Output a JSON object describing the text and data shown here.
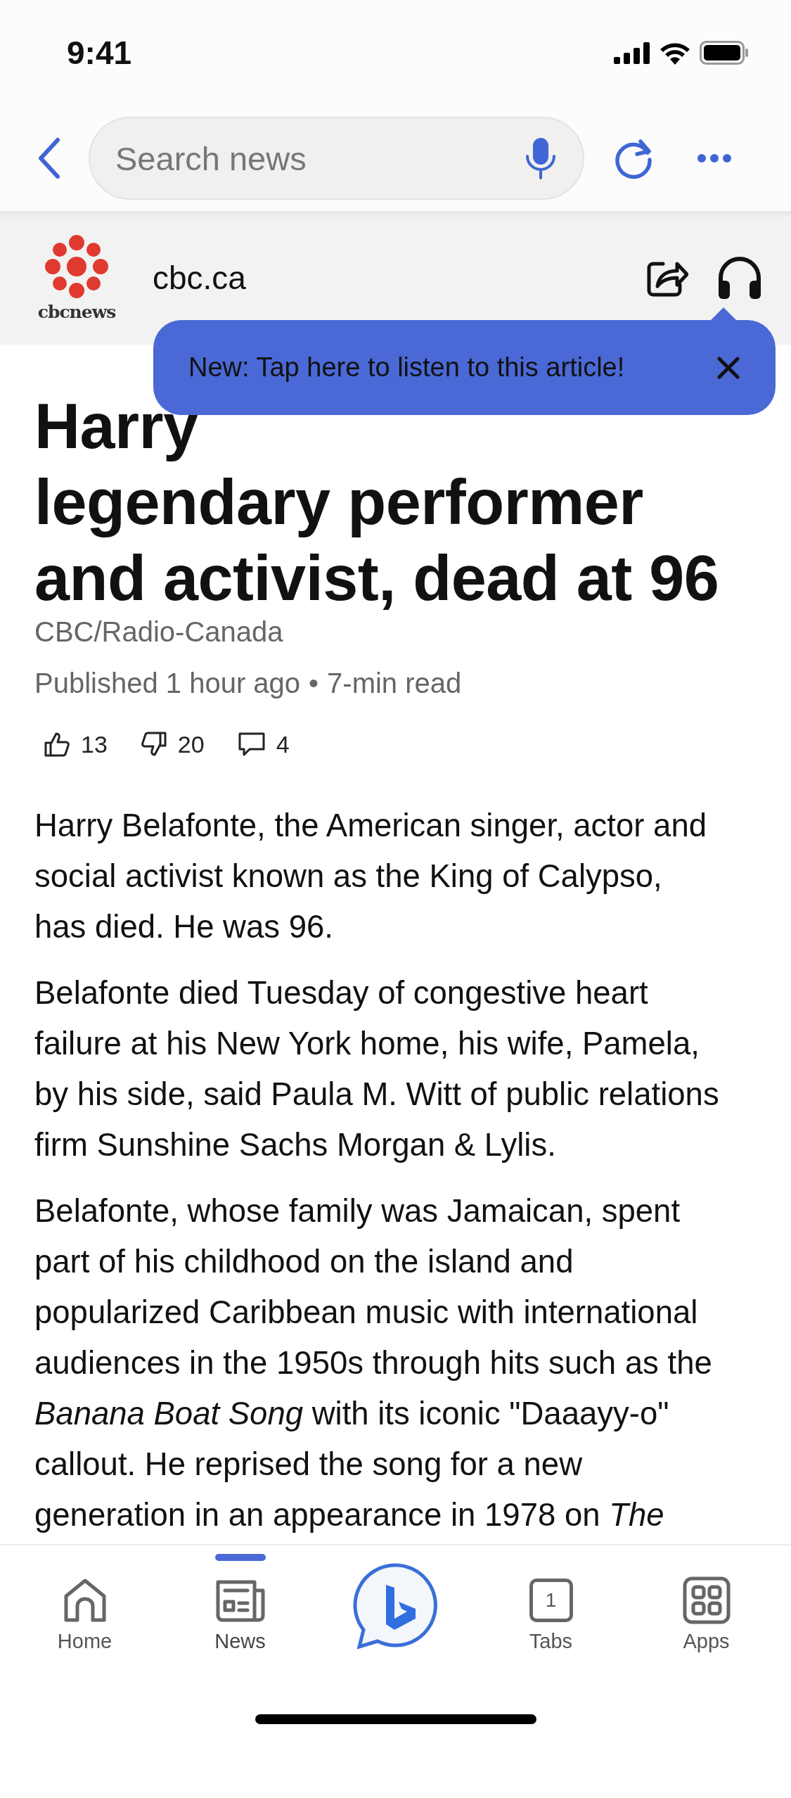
{
  "status_bar": {
    "time": "9:41"
  },
  "toolbar": {
    "search": {
      "placeholder": "Search news"
    }
  },
  "source": {
    "logo_text": "cbcnews",
    "domain": "cbc.ca"
  },
  "tooltip": {
    "text": "New: Tap here to listen to this article!"
  },
  "article": {
    "title_lines": [
      "Harry",
      "legendary performer",
      "and activist, dead at 96"
    ],
    "publisher": "CBC/Radio-Canada",
    "published": "Published 1 hour ago",
    "separator": "•",
    "read_time": "7-min read",
    "reactions": [
      {
        "kind": "like",
        "count": "13"
      },
      {
        "kind": "dislike",
        "count": "20"
      },
      {
        "kind": "comment",
        "count": "4"
      }
    ],
    "paragraphs": [
      "Harry Belafonte, the American singer, actor and social activist known as the King of Calypso, has died. He was 96.",
      "Belafonte died Tuesday of congestive heart failure at his New York home, his wife, Pamela, by his side, said Paula M. Witt of public relations firm Sunshine Sachs Morgan & Lylis.",
      "Belafonte, whose family was Jamaican, spent part of his childhood on the island and popularized Caribbean music with international audiences in the 1950s through hits such as the *Banana Boat Song* with its iconic \"Daaayy-o\" callout. He reprised the song for a new generation in an appearance in 1978 on *The*"
    ]
  },
  "tab_bar": [
    {
      "kind": "home",
      "label": "Home",
      "selected": false
    },
    {
      "kind": "news",
      "label": "News",
      "selected": true
    },
    {
      "kind": "copilot",
      "selected": false
    },
    {
      "kind": "tabs",
      "label": "Tabs",
      "count": "1",
      "selected": false
    },
    {
      "kind": "apps",
      "label": "Apps",
      "selected": false
    }
  ]
}
